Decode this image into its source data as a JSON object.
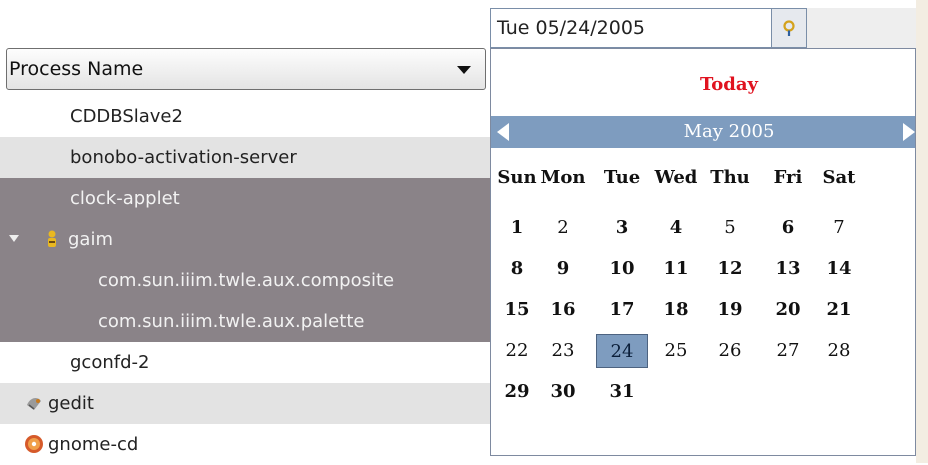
{
  "process_list": {
    "column_header": "Process Name",
    "rows": [
      {
        "name": "CDDBSlave2",
        "indent": 0,
        "selected": false,
        "icon": "none"
      },
      {
        "name": "bonobo-activation-server",
        "indent": 0,
        "selected": false,
        "icon": "none"
      },
      {
        "name": "clock-applet",
        "indent": 0,
        "selected": true,
        "icon": "none"
      },
      {
        "name": "gaim",
        "indent": 0,
        "selected": true,
        "icon": "gaim-person-icon",
        "expanded": true
      },
      {
        "name": "com.sun.iiim.twle.aux.composite",
        "indent": 1,
        "selected": true,
        "icon": "none"
      },
      {
        "name": "com.sun.iiim.twle.aux.palette",
        "indent": 1,
        "selected": true,
        "icon": "none"
      },
      {
        "name": "gconfd-2",
        "indent": 0,
        "selected": false,
        "icon": "none"
      },
      {
        "name": "gedit",
        "indent": 0,
        "selected": false,
        "icon": "gedit-icon"
      },
      {
        "name": "gnome-cd",
        "indent": 0,
        "selected": false,
        "icon": "gnome-cd-icon"
      }
    ]
  },
  "date_picker": {
    "value": "Tue 05/24/2005",
    "button_icon": "calendar-pin-icon",
    "today_label": "Today",
    "month_label": "May 2005",
    "weekdays": [
      "Sun",
      "Mon",
      "Tue",
      "Wed",
      "Thu",
      "Fri",
      "Sat"
    ],
    "first_weekday_index": 0,
    "days": [
      "1",
      "2",
      "3",
      "4",
      "5",
      "6",
      "7",
      "8",
      "9",
      "10",
      "11",
      "12",
      "13",
      "14",
      "15",
      "16",
      "17",
      "18",
      "19",
      "20",
      "21",
      "22",
      "23",
      "24",
      "25",
      "26",
      "27",
      "28",
      "29",
      "30",
      "31"
    ],
    "bold_days": [
      "1",
      "3",
      "4",
      "6",
      "8",
      "9",
      "10",
      "11",
      "12",
      "13",
      "14",
      "15",
      "16",
      "17",
      "18",
      "19",
      "20",
      "21",
      "29",
      "30",
      "31"
    ],
    "selected_day": "24",
    "colors": {
      "accent": "#7e9cbf",
      "today": "#e0121f",
      "selected_row": "#8a8388"
    }
  }
}
